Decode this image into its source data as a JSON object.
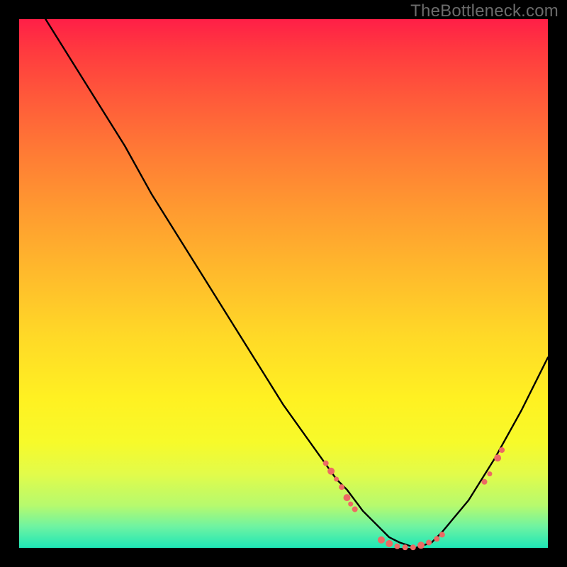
{
  "watermark": "TheBottleneck.com",
  "chart_data": {
    "type": "line",
    "title": "",
    "xlabel": "",
    "ylabel": "",
    "xlim": [
      0,
      100
    ],
    "ylim": [
      0,
      100
    ],
    "grid": false,
    "legend": false,
    "series": [
      {
        "name": "bottleneck-curve",
        "color": "#000000",
        "x": [
          5,
          10,
          15,
          20,
          25,
          30,
          35,
          40,
          45,
          50,
          55,
          60,
          62,
          65,
          68,
          70,
          72,
          75,
          78,
          80,
          85,
          90,
          95,
          100
        ],
        "y": [
          100,
          92,
          84,
          76,
          67,
          59,
          51,
          43,
          35,
          27,
          20,
          13,
          11,
          7,
          4,
          2,
          1,
          0,
          1,
          3,
          9,
          17,
          26,
          36
        ]
      }
    ],
    "scatter": [
      {
        "name": "marker-dots",
        "color": "#ec6a64",
        "points": [
          {
            "x": 58,
            "y": 16,
            "r": 4
          },
          {
            "x": 59,
            "y": 14.5,
            "r": 5
          },
          {
            "x": 60,
            "y": 13,
            "r": 3.5
          },
          {
            "x": 61,
            "y": 11.5,
            "r": 4
          },
          {
            "x": 62,
            "y": 9.5,
            "r": 5
          },
          {
            "x": 62.7,
            "y": 8.3,
            "r": 3.5
          },
          {
            "x": 63.5,
            "y": 7.3,
            "r": 4
          },
          {
            "x": 68.5,
            "y": 1.5,
            "r": 5
          },
          {
            "x": 70,
            "y": 0.8,
            "r": 5
          },
          {
            "x": 71.5,
            "y": 0.3,
            "r": 4
          },
          {
            "x": 73,
            "y": 0.1,
            "r": 4
          },
          {
            "x": 74.5,
            "y": 0.1,
            "r": 4
          },
          {
            "x": 76,
            "y": 0.5,
            "r": 5
          },
          {
            "x": 77.5,
            "y": 1.0,
            "r": 4
          },
          {
            "x": 79,
            "y": 1.7,
            "r": 4
          },
          {
            "x": 80,
            "y": 2.5,
            "r": 4
          },
          {
            "x": 88,
            "y": 12.5,
            "r": 4
          },
          {
            "x": 89,
            "y": 14,
            "r": 3.5
          },
          {
            "x": 90.5,
            "y": 17,
            "r": 5
          },
          {
            "x": 91.3,
            "y": 18.5,
            "r": 4
          }
        ]
      }
    ]
  }
}
